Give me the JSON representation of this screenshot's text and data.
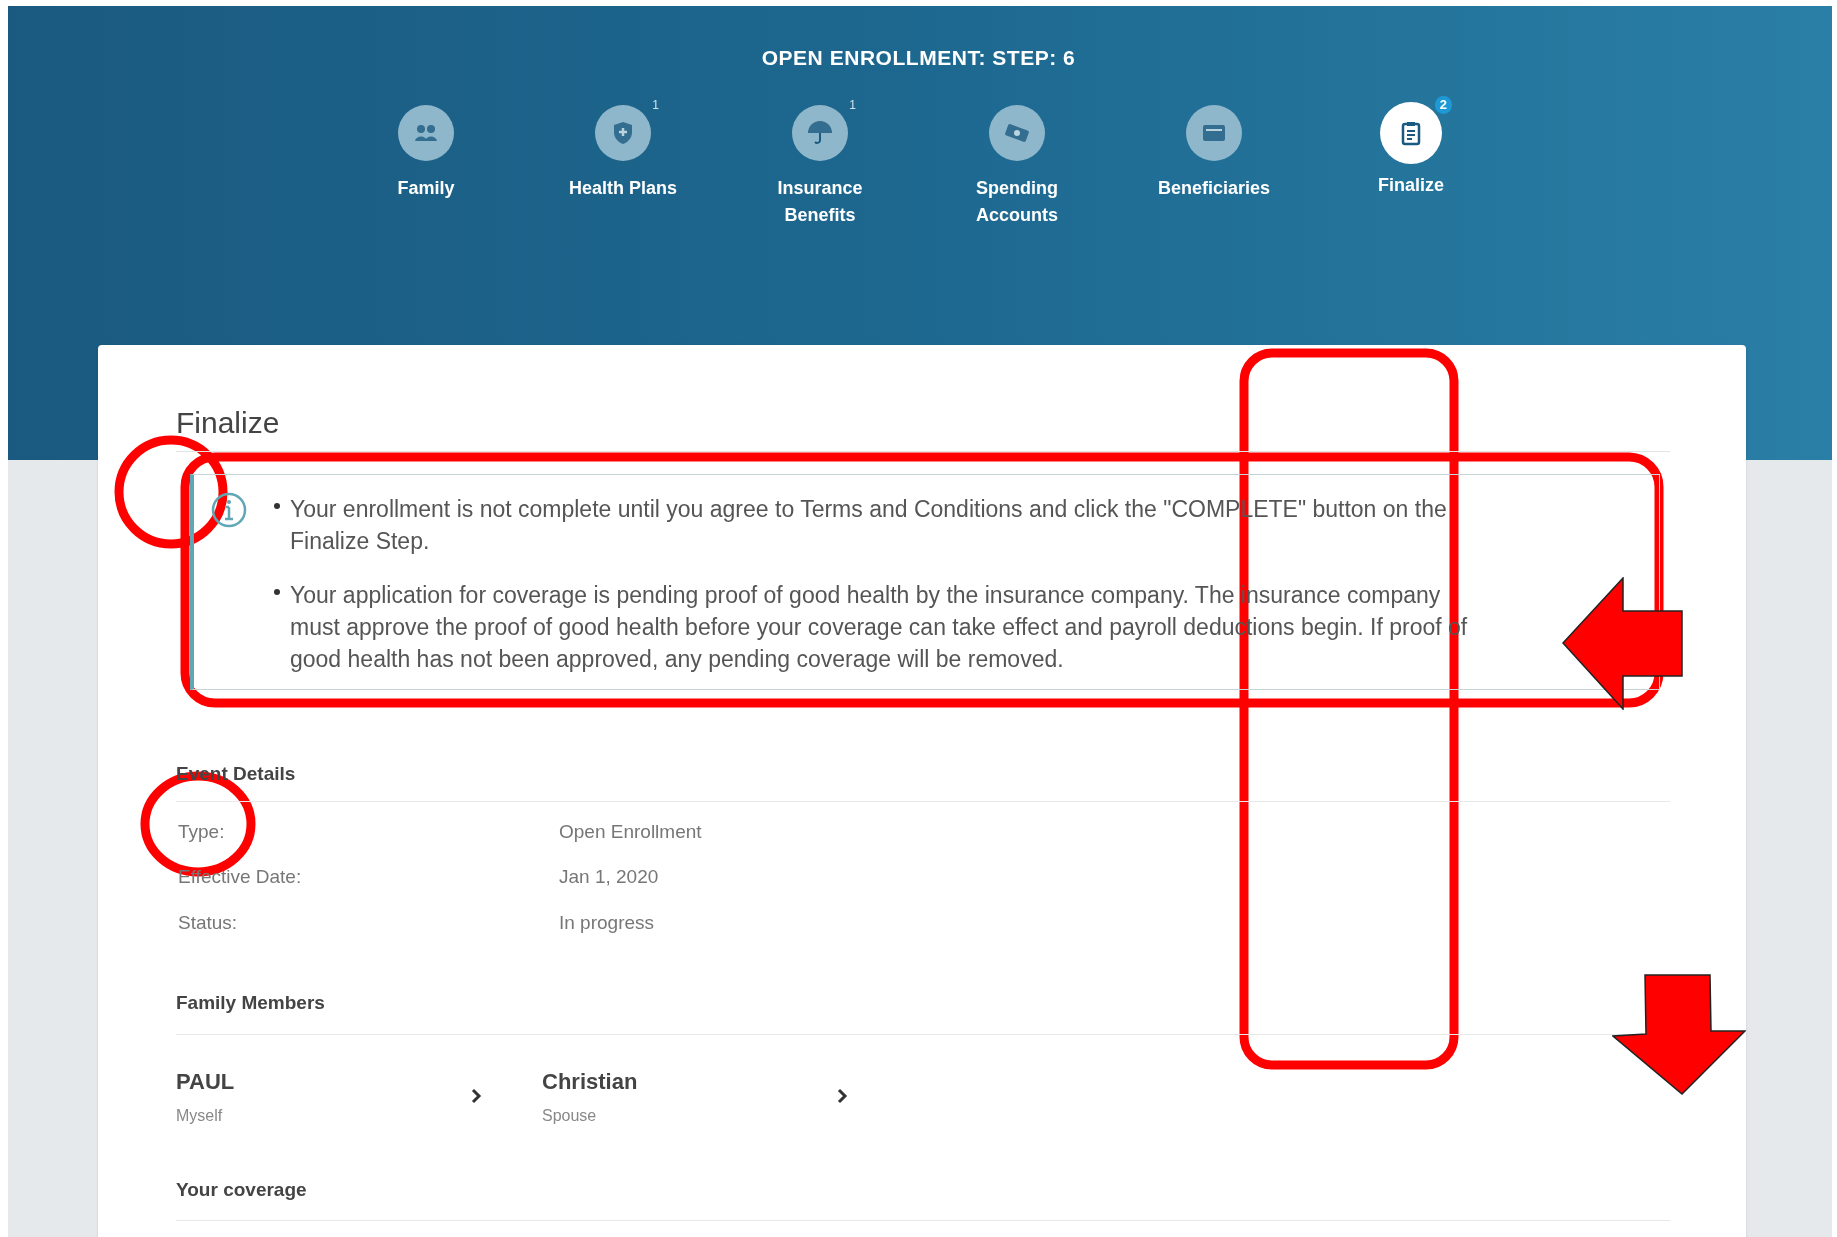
{
  "header": {
    "title": "OPEN ENROLLMENT: STEP: 6"
  },
  "steps": [
    {
      "label": "Family",
      "kind": "family",
      "selected": false
    },
    {
      "label": "Health Plans",
      "kind": "shield",
      "badge": "1",
      "selected": false
    },
    {
      "label": "Insurance Benefits",
      "kind": "umbrella",
      "badge": "1",
      "selected": false
    },
    {
      "label": "Spending Accounts",
      "kind": "money",
      "selected": false
    },
    {
      "label": "Beneficiaries",
      "kind": "card",
      "selected": false
    },
    {
      "label": "Finalize",
      "kind": "clipboard",
      "badge": "2",
      "selected": true
    }
  ],
  "page_title": "Finalize",
  "notices": [
    "Your enrollment is not complete until you agree to Terms and Conditions and click the \"COMPLETE\" button on the Finalize Step.",
    "Your application for coverage is pending proof of good health by the insurance company. The insurance company must approve the proof of good health before your coverage can take effect and payroll deductions begin. If proof of good health has not been approved, any pending coverage will be removed."
  ],
  "event_details": {
    "heading": "Event Details",
    "rows": [
      {
        "label": "Type:",
        "value": "Open Enrollment"
      },
      {
        "label": "Effective Date:",
        "value": "Jan 1, 2020"
      },
      {
        "label": "Status:",
        "value": "In progress"
      }
    ]
  },
  "family_members": {
    "heading": "Family Members",
    "members": [
      {
        "name": "PAUL",
        "relation": "Myself"
      },
      {
        "name": "Christian",
        "relation": "Spouse"
      }
    ]
  },
  "coverage": {
    "heading": "Your coverage"
  }
}
